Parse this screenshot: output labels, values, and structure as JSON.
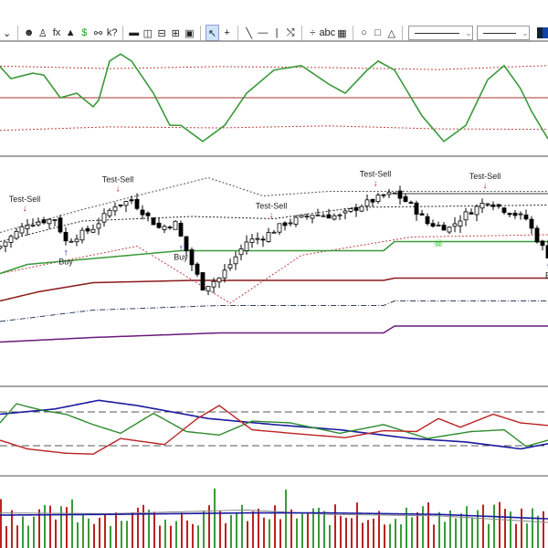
{
  "toolbar": {
    "items": [
      "⌄",
      "☻",
      "♙",
      "fx",
      "▲",
      "$",
      "⚯",
      "k?",
      "▬",
      "◫",
      "⊟",
      "⊞",
      "▣",
      "↖",
      "+",
      "╲",
      "—",
      "|",
      "⤭",
      "÷",
      "abc",
      "▦",
      "○",
      "□",
      "△",
      "⌄",
      "⌄"
    ]
  },
  "signals": [
    {
      "label": "Test-Sell",
      "idx": 5,
      "type": "sell"
    },
    {
      "label": "Test-Sell",
      "idx": 22,
      "type": "sell"
    },
    {
      "label": "Test-Sell",
      "idx": 50,
      "type": "sell"
    },
    {
      "label": "Test-Sell",
      "idx": 69,
      "type": "sell"
    },
    {
      "label": "Test-Sell",
      "idx": 89,
      "type": "sell"
    },
    {
      "label": "Buy",
      "idx": 12,
      "type": "buy"
    },
    {
      "label": "Buy",
      "idx": 33,
      "type": "buy"
    },
    {
      "label": "B",
      "idx": 100,
      "type": "buy"
    }
  ],
  "colors": {
    "up": "#ffffff",
    "down": "#000000",
    "osc": "#3a9a3a",
    "red": "#aa2222",
    "blue": "#1a1aa0",
    "green": "#2e8b2e",
    "purple": "#6a1a7a"
  },
  "chart_data": [
    {
      "type": "line",
      "name": "oscillator",
      "ylim": [
        -100,
        100
      ],
      "x": [
        0,
        2,
        6,
        8,
        11,
        14,
        17,
        18,
        20,
        22,
        24,
        28,
        31,
        33,
        37,
        41,
        45,
        50,
        55,
        60,
        63,
        67,
        69,
        72,
        77,
        81,
        85,
        89,
        92,
        95,
        97,
        100
      ],
      "values": [
        62,
        38,
        49,
        45,
        0,
        9,
        -18,
        -5,
        73,
        87,
        73,
        9,
        -55,
        -55,
        -87,
        -55,
        9,
        55,
        64,
        27,
        9,
        55,
        73,
        55,
        -36,
        -87,
        -55,
        36,
        64,
        18,
        -27,
        -82
      ],
      "mid": 0,
      "upper_band": 65,
      "lower_band": -65
    },
    {
      "type": "candlestick",
      "name": "price",
      "ylim": [
        0,
        100
      ],
      "anchor_idx": [
        0,
        5,
        10,
        12,
        17,
        21,
        24,
        29,
        32,
        35,
        37,
        40,
        42,
        45,
        48,
        52,
        57,
        62,
        66,
        70,
        72,
        75,
        78,
        82,
        85,
        89,
        92,
        96,
        98,
        100
      ],
      "anchor_close": [
        61,
        71,
        73,
        63,
        69,
        79,
        81,
        69,
        71,
        53,
        43,
        47,
        53,
        63,
        65,
        71,
        75,
        74,
        79,
        83,
        84,
        79,
        71,
        69,
        75,
        81,
        77,
        73,
        64,
        57
      ]
    },
    {
      "type": "line",
      "name": "oscillator2",
      "ylim": [
        0,
        100
      ],
      "series": [
        "blue",
        "green",
        "red"
      ]
    },
    {
      "type": "bar",
      "name": "volume"
    }
  ]
}
